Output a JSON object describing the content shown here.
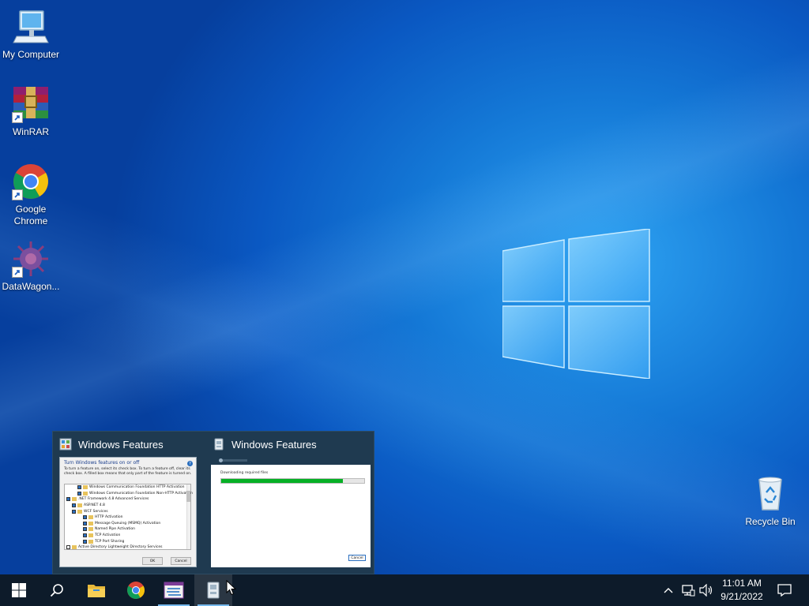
{
  "desktop": {
    "icons": [
      {
        "label": "My Computer",
        "icon": "monitor-icon"
      },
      {
        "label": "WinRAR",
        "icon": "winrar-icon"
      },
      {
        "label": "Google Chrome",
        "icon": "chrome-icon"
      },
      {
        "label": "DataWagon...",
        "icon": "datawagon-icon"
      },
      {
        "label": "Recycle Bin",
        "icon": "recycle-bin-icon"
      }
    ]
  },
  "thumbnails": [
    {
      "title": "Windows Features",
      "heading": "Turn Windows features on or off",
      "description": "To turn a feature on, select its check box. To turn a feature off, clear its check box. A filled box means that only part of the feature is turned on.",
      "tree": [
        {
          "label": "Windows Communication Foundation HTTP Activation",
          "checked": true,
          "indent": 2
        },
        {
          "label": "Windows Communication Foundation Non-HTTP Activation",
          "checked": true,
          "indent": 2
        },
        {
          "label": ".NET Framework 4.8 Advanced Services",
          "checked": true,
          "indent": 0
        },
        {
          "label": "ASP.NET 4.8",
          "checked": true,
          "indent": 1
        },
        {
          "label": "WCF Services",
          "checked": true,
          "indent": 1
        },
        {
          "label": "HTTP Activation",
          "checked": true,
          "indent": 2
        },
        {
          "label": "Message Queuing (MSMQ) Activation",
          "checked": true,
          "indent": 2
        },
        {
          "label": "Named Pipe Activation",
          "checked": true,
          "indent": 2
        },
        {
          "label": "TCP Activation",
          "checked": true,
          "indent": 2
        },
        {
          "label": "TCP Port Sharing",
          "checked": true,
          "indent": 2
        },
        {
          "label": "Active Directory Lightweight Directory Services",
          "checked": false,
          "indent": 0
        }
      ],
      "ok_label": "OK",
      "cancel_label": "Cancel"
    },
    {
      "title": "Windows Features",
      "status_text": "Downloading required files",
      "progress": 0.85,
      "cancel_label": "Cancel"
    }
  ],
  "taskbar": {
    "start_icon": "windows-start-icon",
    "search_icon": "search-icon",
    "pinned": [
      "file-explorer-icon",
      "chrome-icon",
      "datawagon-icon",
      "windows-features-icon"
    ],
    "tray": [
      "chevron-up-icon",
      "network-icon",
      "volume-icon"
    ],
    "time": "11:01 AM",
    "date": "9/21/2022",
    "notification_icon": "action-center-icon"
  },
  "colors": {
    "taskbar": "#0d1b2a",
    "accent": "#76b9ed",
    "progress": "#06b025"
  }
}
